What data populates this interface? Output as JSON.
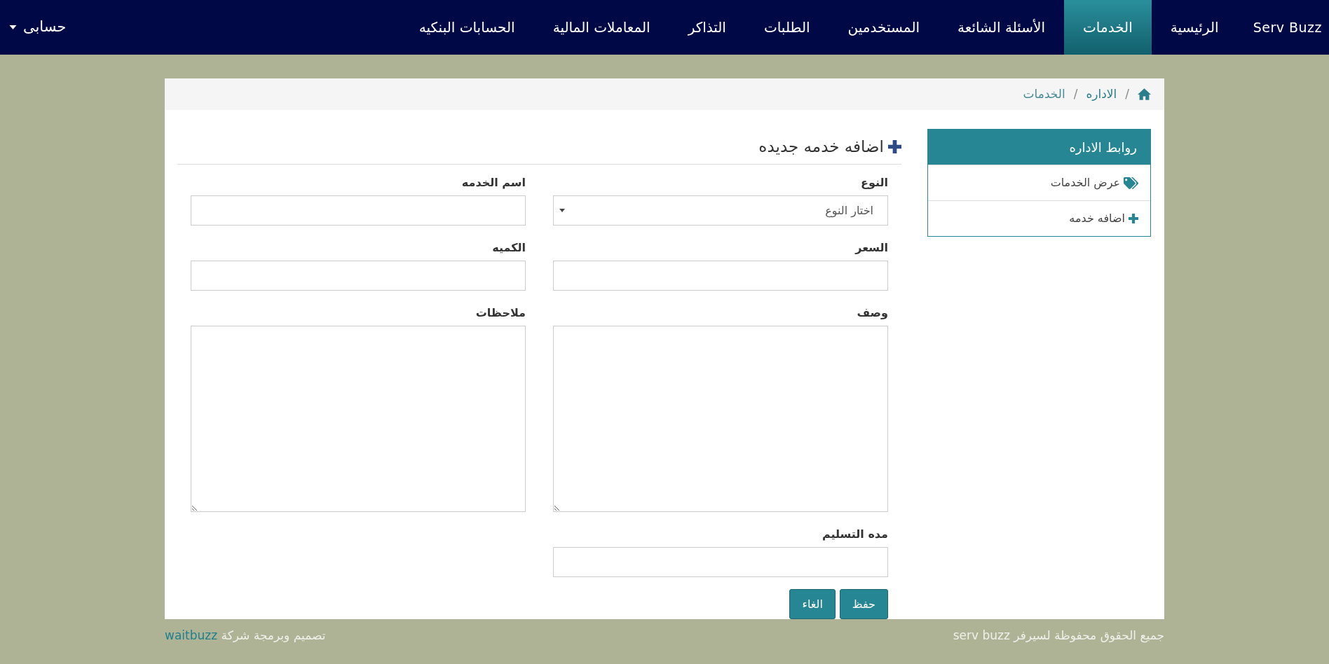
{
  "navbar": {
    "brand": "Serv Buzz",
    "items": [
      {
        "label": "الرئيسية",
        "selected": false
      },
      {
        "label": "الخدمات",
        "selected": true
      },
      {
        "label": "الأسئلة الشائعة",
        "selected": false
      },
      {
        "label": "المستخدمين",
        "selected": false
      },
      {
        "label": "الطلبات",
        "selected": false
      },
      {
        "label": "التذاكر",
        "selected": false
      },
      {
        "label": "المعاملات المالية",
        "selected": false
      },
      {
        "label": "الحسابات البنكيه",
        "selected": false
      }
    ],
    "account": {
      "label": "حسابى"
    }
  },
  "breadcrumb": [
    {
      "kind": "home"
    },
    {
      "kind": "link",
      "separator": "/",
      "label": "الاداره"
    },
    {
      "kind": "current",
      "separator": "/",
      "label": "الخدمات"
    }
  ],
  "sidebar": {
    "title": "روابط الاداره",
    "items": [
      {
        "kind": "view",
        "label": "عرض الخدمات"
      },
      {
        "kind": "add",
        "label": "اضافه خدمه"
      }
    ]
  },
  "form": {
    "title": "اضافه خدمه جديده",
    "fields": [
      {
        "kind": "select",
        "label": "النوع",
        "value": "اختار النوع"
      },
      {
        "kind": "input",
        "label": "اسم الخدمه"
      },
      {
        "kind": "input",
        "label": "السعر"
      },
      {
        "kind": "input",
        "label": "الكميه"
      },
      {
        "kind": "textarea",
        "label": "وصف"
      },
      {
        "kind": "textarea",
        "label": "ملاحظات"
      },
      {
        "kind": "input",
        "label": "مده التسليم"
      }
    ],
    "buttons": [
      {
        "label": "حفظ"
      },
      {
        "label": "الغاء"
      }
    ]
  },
  "footer": {
    "copyright": "جميع الحقوق محفوظة لسيرفر serv buzz",
    "credit_text": "تصميم وبرمجة شركة",
    "credit_link": "waitbuzz"
  }
}
